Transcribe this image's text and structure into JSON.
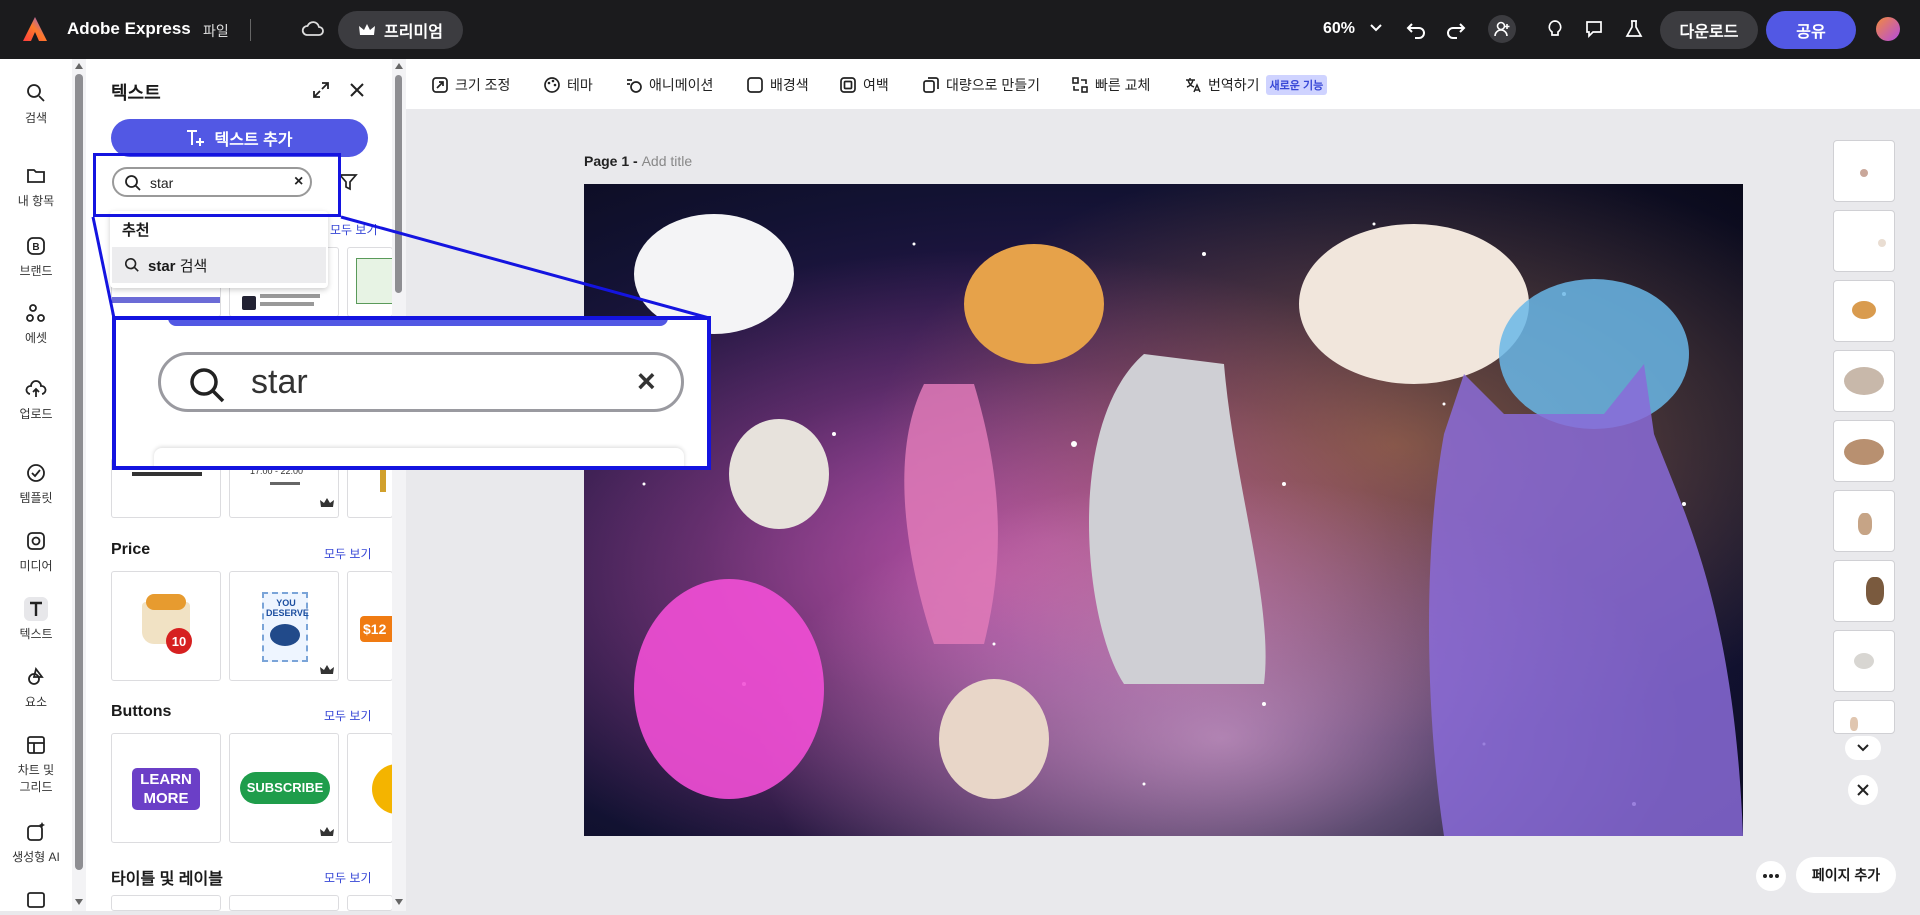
{
  "topbar": {
    "app_name": "Adobe Express",
    "file_menu": "파일",
    "premium_label": "프리미엄",
    "zoom": "60%",
    "download_label": "다운로드",
    "share_label": "공유",
    "brand_color": "#5258e4"
  },
  "rail": {
    "items": [
      {
        "label": "검색",
        "icon": "search-icon"
      },
      {
        "label": "내 항목",
        "icon": "folder-icon"
      },
      {
        "label": "브랜드",
        "icon": "brand-icon"
      },
      {
        "label": "에셋",
        "icon": "assets-icon"
      },
      {
        "label": "업로드",
        "icon": "upload-icon"
      },
      {
        "label": "템플릿",
        "icon": "templates-icon"
      },
      {
        "label": "미디어",
        "icon": "media-icon"
      },
      {
        "label": "텍스트",
        "icon": "text-icon"
      },
      {
        "label": "요소",
        "icon": "elements-icon"
      },
      {
        "label": "차트 및",
        "label2": "그리드",
        "icon": "chart-grid-icon"
      },
      {
        "label": "생성형 AI",
        "icon": "generative-ai-icon"
      }
    ]
  },
  "panel": {
    "title": "텍스트",
    "add_text_label": "텍스트 추가",
    "search_value": "star",
    "suggest_title": "추천",
    "suggest_query": "star",
    "suggest_suffix": "검색",
    "see_all_partial": "모두 보기",
    "sections": [
      {
        "title": "Price",
        "see_all": "모두 보기"
      },
      {
        "title": "Buttons",
        "see_all": "모두 보기"
      },
      {
        "title": "타이틀 및 레이블",
        "see_all": "모두 보기"
      }
    ],
    "card_texts": {
      "you_deserve": "YOU DESERVE",
      "price_tag": "$12",
      "learn": "LEARN",
      "more": "MORE",
      "subscribe": "SUBSCRIBE",
      "time": "17:00 - 22:00"
    }
  },
  "toolbar": {
    "tools": [
      {
        "label": "크기 조정",
        "icon": "resize-icon"
      },
      {
        "label": "테마",
        "icon": "theme-icon"
      },
      {
        "label": "애니메이션",
        "icon": "animation-icon"
      },
      {
        "label": "배경색",
        "icon": "background-color-icon"
      },
      {
        "label": "여백",
        "icon": "margin-icon"
      },
      {
        "label": "대량으로 만들기",
        "icon": "bulk-create-icon"
      },
      {
        "label": "빠른 교체",
        "icon": "quick-swap-icon"
      },
      {
        "label": "번역하기",
        "icon": "translate-icon"
      }
    ],
    "new_badge": "새로운 기능"
  },
  "canvas": {
    "page_label": "Page 1 - ",
    "title_placeholder": "Add title"
  },
  "pages_rail": {
    "add_page_label": "페이지 추가"
  },
  "zoom_callout": {
    "search_value": "star"
  }
}
